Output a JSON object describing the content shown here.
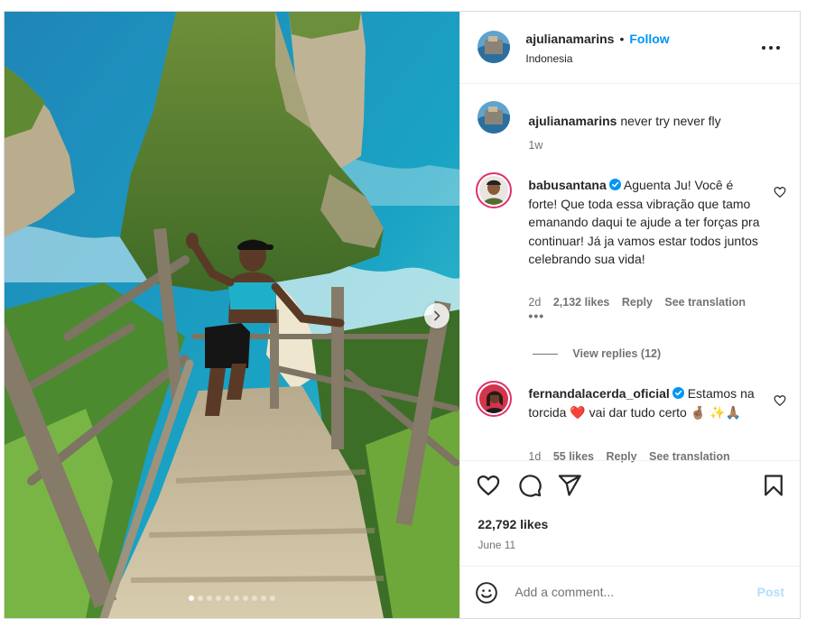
{
  "post": {
    "username": "ajulianamarins",
    "separator": "•",
    "follow_label": "Follow",
    "location": "Indonesia",
    "more_icon": "more-horizontal-icon",
    "media": {
      "alt": "Woman in a black cap waving on wooden stairs above turquoise sea and green cliffs",
      "next_icon": "chevron-right-icon",
      "slide_count": 10,
      "active_slide": 1
    },
    "caption": {
      "username": "ajulianamarins",
      "text": "never try never fly",
      "time": "1w"
    },
    "comments": [
      {
        "username": "babusantana",
        "verified": true,
        "text": "Aguenta Ju! Você é forte! Que toda essa vibração que tamo emanando daqui te ajude a ter forças pra continuar! Já ja vamos estar todos juntos celebrando sua vida!",
        "time": "2d",
        "likes": "2,132 likes",
        "reply": "Reply",
        "translate": "See translation",
        "more": "•••",
        "view_replies": "View replies (12)"
      },
      {
        "username": "fernandalacerda_oficial",
        "verified": true,
        "text": "Estamos na torcida ❤️ vai dar tudo certo 🤞🏽 ✨🙏🏽",
        "time": "1d",
        "likes": "55 likes",
        "reply": "Reply",
        "translate": "See translation"
      }
    ],
    "actions": {
      "like_icon": "heart-icon",
      "comment_icon": "comment-icon",
      "share_icon": "send-icon",
      "save_icon": "bookmark-icon"
    },
    "likes": "22,792 likes",
    "date": "June 11",
    "add_comment": {
      "placeholder": "Add a comment...",
      "post_label": "Post",
      "emoji_icon": "emoji-icon"
    }
  },
  "colors": {
    "link_blue": "#0095f6",
    "post_disabled": "#b2dffc",
    "verified": "#0095f6",
    "text_secondary": "#737373",
    "border": "#dbdbdb"
  }
}
